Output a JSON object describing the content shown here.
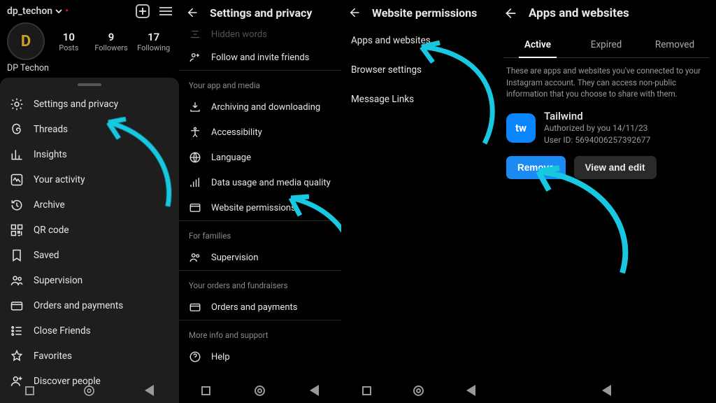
{
  "profile": {
    "username": "dp_techon",
    "display_name": "DP Techon",
    "stats": {
      "posts": {
        "n": "10",
        "label": "Posts"
      },
      "followers": {
        "n": "9",
        "label": "Followers"
      },
      "following": {
        "n": "17",
        "label": "Following"
      }
    },
    "avatar_letter": "D",
    "menu": [
      {
        "label": "Settings and privacy",
        "icon": "gear-icon"
      },
      {
        "label": "Threads",
        "icon": "threads-icon"
      },
      {
        "label": "Insights",
        "icon": "chart-icon"
      },
      {
        "label": "Your activity",
        "icon": "activity-icon"
      },
      {
        "label": "Archive",
        "icon": "clock-icon"
      },
      {
        "label": "QR code",
        "icon": "qr-icon"
      },
      {
        "label": "Saved",
        "icon": "bookmark-icon"
      },
      {
        "label": "Supervision",
        "icon": "people-icon"
      },
      {
        "label": "Orders and payments",
        "icon": "card-icon"
      },
      {
        "label": "Close Friends",
        "icon": "list-icon"
      },
      {
        "label": "Favorites",
        "icon": "star-icon"
      },
      {
        "label": "Discover people",
        "icon": "adduser-icon"
      }
    ]
  },
  "settings": {
    "title": "Settings and privacy",
    "hidden_prev": "Hidden words",
    "follow_invite": "Follow and invite friends",
    "group_app_media": "Your app and media",
    "items_app_media": [
      "Archiving and downloading",
      "Accessibility",
      "Language",
      "Data usage and media quality",
      "Website permissions"
    ],
    "group_families": "For families",
    "supervision": "Supervision",
    "group_orders": "Your orders and fundraisers",
    "orders": "Orders and payments",
    "group_more": "More info and support",
    "help": "Help"
  },
  "web_perms": {
    "title": "Website permissions",
    "items": [
      "Apps and websites",
      "Browser settings",
      "Message Links"
    ]
  },
  "apps": {
    "title": "Apps and websites",
    "tabs": {
      "active": "Active",
      "expired": "Expired",
      "removed": "Removed"
    },
    "desc": "These are apps and websites you've connected to your Instagram account. They can access non-public information that you choose to share with them.",
    "app": {
      "name": "Tailwind",
      "auth": "Authorized by you 14/11/23",
      "uid": "User ID: 5694006257392677",
      "icon_text": "tw"
    },
    "buttons": {
      "remove": "Remove",
      "view": "View and edit"
    }
  }
}
